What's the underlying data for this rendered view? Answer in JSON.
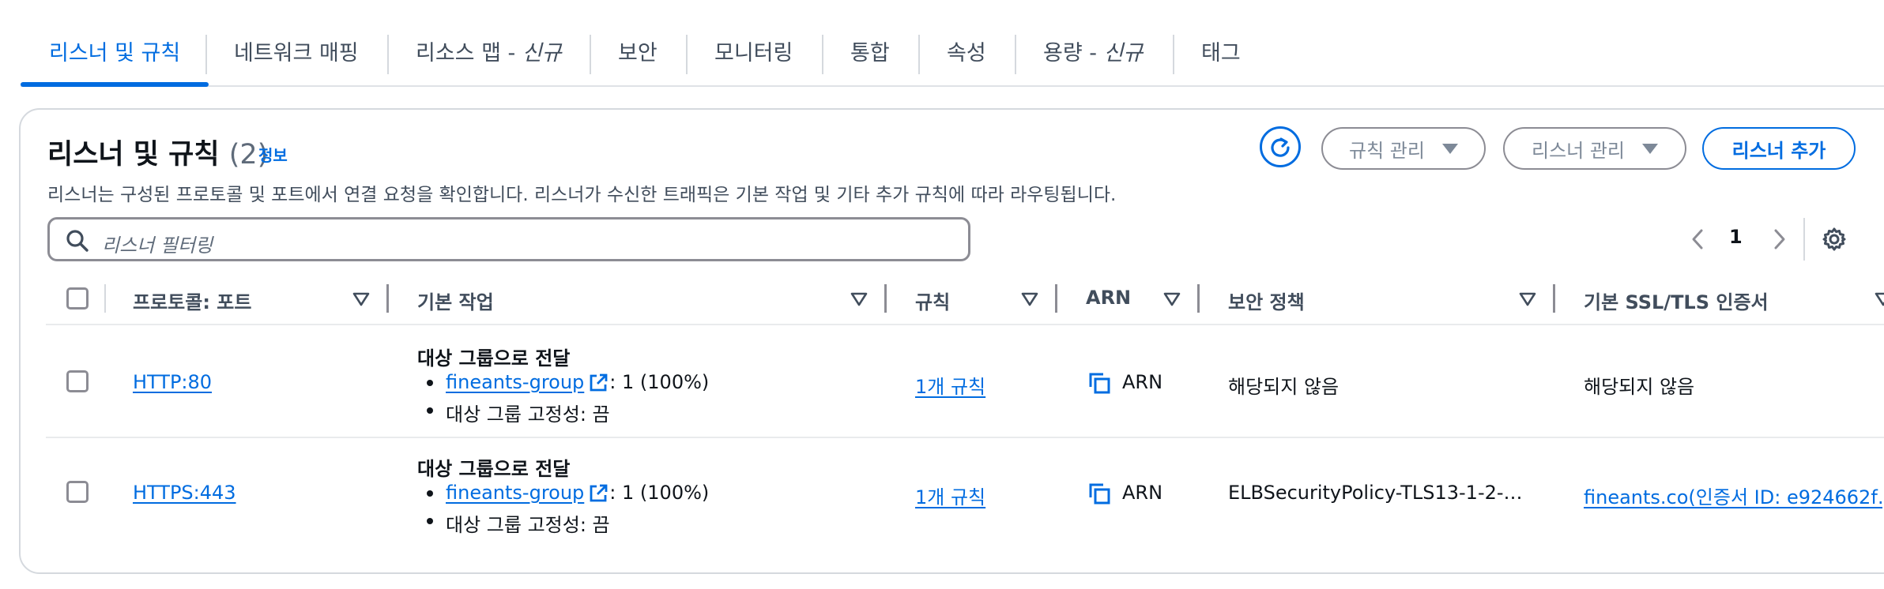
{
  "tabs": [
    {
      "label": "리스너 및 규칙",
      "suffix": ""
    },
    {
      "label": "네트워크 매핑",
      "suffix": ""
    },
    {
      "label": "리소스 맵 - ",
      "suffix": "신규"
    },
    {
      "label": "보안",
      "suffix": ""
    },
    {
      "label": "모니터링",
      "suffix": ""
    },
    {
      "label": "통합",
      "suffix": ""
    },
    {
      "label": "속성",
      "suffix": ""
    },
    {
      "label": "용량 - ",
      "suffix": "신규"
    },
    {
      "label": "태그",
      "suffix": ""
    }
  ],
  "panel": {
    "title": "리스너 및 규칙",
    "count": "(2)",
    "info": "정보",
    "description": "리스너는 구성된 프로토콜 및 포트에서 연결 요청을 확인합니다. 리스너가 수신한 트래픽은 기본 작업 및 기타 추가 규칙에 따라 라우팅됩니다.",
    "buttons": {
      "manage_rules": "규칙 관리",
      "manage_listener": "리스너 관리",
      "add_listener": "리스너 추가"
    },
    "search": {
      "placeholder": "리스너 필터링"
    },
    "page": "1"
  },
  "table": {
    "headers": [
      "프로토콜: 포트",
      "기본 작업",
      "규칙",
      "ARN",
      "보안 정책",
      "기본 SSL/TLS 인증서"
    ],
    "rows": [
      {
        "protocol_port": "HTTP:80",
        "action_title": "대상 그룹으로 전달",
        "target_group": "fineants-group",
        "weight": ": 1 (100%)",
        "stickiness": "대상 그룹 고정성: 끔",
        "rules": "1개 규칙",
        "arn": "ARN",
        "security_policy": "해당되지 않음",
        "certificate": "해당되지 않음"
      },
      {
        "protocol_port": "HTTPS:443",
        "action_title": "대상 그룹으로 전달",
        "target_group": "fineants-group",
        "weight": ": 1 (100%)",
        "stickiness": "대상 그룹 고정성: 끔",
        "rules": "1개 규칙",
        "arn": "ARN",
        "security_policy": "ELBSecurityPolicy-TLS13-1-2-…",
        "certificate": "fineants.co(인증서 ID: e924662f…"
      }
    ]
  },
  "colors": {
    "accent": "#006ce0",
    "text": "#0f141a",
    "muted": "#414d5c",
    "border": "#8c8c94"
  },
  "icons": [
    "refresh-icon",
    "caret-down-icon",
    "search-icon",
    "chevron-left-icon",
    "chevron-right-icon",
    "gear-icon",
    "sort-icon",
    "external-link-icon",
    "copy-icon"
  ]
}
